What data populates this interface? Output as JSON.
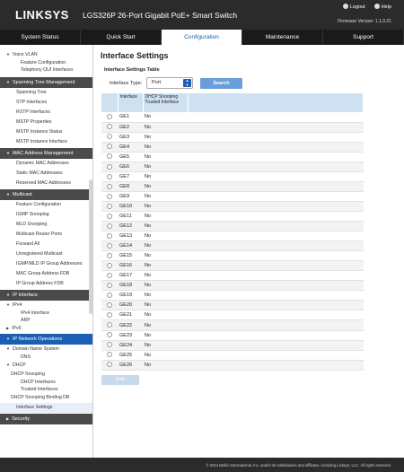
{
  "header": {
    "logo": "LINKSYS",
    "product": "LGS326P 26-Port Gigabit PoE+ Smart Switch",
    "logout": "Logout",
    "help": "Help",
    "firmware": "Firmware Version: 1.1.0.21"
  },
  "nav": {
    "tabs": [
      {
        "label": "System Status"
      },
      {
        "label": "Quick Start"
      },
      {
        "label": "Configuration"
      },
      {
        "label": "Maintenance"
      },
      {
        "label": "Support"
      }
    ]
  },
  "sidebar": {
    "voice_vlan": "Voice VLAN",
    "vv_items": [
      "Feature Configuration",
      "Telephony OUI Interfaces"
    ],
    "stm": "Spanning Tree Management",
    "stm_items": [
      "Spanning Tree",
      "STP Interfaces",
      "RSTP Interfaces",
      "MSTP Properties",
      "MSTP Instance Status",
      "MSTP Instance Interface"
    ],
    "mac": "MAC Address Management",
    "mac_items": [
      "Dynamic MAC Addresses",
      "Static MAC Addresses",
      "Reserved MAC Addresses"
    ],
    "multicast": "Multicast",
    "mc_items": [
      "Feature Configuration",
      "IGMP Snooping",
      "MLD Snooping",
      "Multicast Router Ports",
      "Forward All",
      "Unregistered Multicast",
      "IGMP/MLD IP Group Addresses",
      "MAC Group Address FDB",
      "IP Group Address FDB"
    ],
    "ip_interface": "IP Interface",
    "ipv4": "IPv4",
    "ipv4_items": [
      "IPv4 Interface",
      "ARP"
    ],
    "ipv6": "IPv6",
    "ip_net_ops": "IP Network Operations",
    "dns_group": "Domain Name System",
    "dns": "DNS",
    "dhcp": "DHCP",
    "dhcp_items": [
      "DHCP Snooping",
      "DHCP Interfaces",
      "Trusted Interfaces"
    ],
    "dhcp_binding": "DHCP Snooping Binding DB",
    "iface_settings": "Interface Settings",
    "security": "Security"
  },
  "main": {
    "title": "Interface Settings",
    "table_title": "Interface Settings Table",
    "iface_type_label": "Interface Type:",
    "iface_type_value": "Port",
    "search_label": "Search",
    "col_interface": "Interface",
    "col_dhcp": "DHCP Snooping Trusted Interface",
    "rows": [
      {
        "if": "GE1",
        "v": "No"
      },
      {
        "if": "GE2",
        "v": "No"
      },
      {
        "if": "GE3",
        "v": "No"
      },
      {
        "if": "GE4",
        "v": "No"
      },
      {
        "if": "GE5",
        "v": "No"
      },
      {
        "if": "GE6",
        "v": "No"
      },
      {
        "if": "GE7",
        "v": "No"
      },
      {
        "if": "GE8",
        "v": "No"
      },
      {
        "if": "GE9",
        "v": "No"
      },
      {
        "if": "GE10",
        "v": "No"
      },
      {
        "if": "GE11",
        "v": "No"
      },
      {
        "if": "GE12",
        "v": "No"
      },
      {
        "if": "GE13",
        "v": "No"
      },
      {
        "if": "GE14",
        "v": "No"
      },
      {
        "if": "GE15",
        "v": "No"
      },
      {
        "if": "GE16",
        "v": "No"
      },
      {
        "if": "GE17",
        "v": "No"
      },
      {
        "if": "GE18",
        "v": "No"
      },
      {
        "if": "GE19",
        "v": "No"
      },
      {
        "if": "GE20",
        "v": "No"
      },
      {
        "if": "GE21",
        "v": "No"
      },
      {
        "if": "GE22",
        "v": "No"
      },
      {
        "if": "GE23",
        "v": "No"
      },
      {
        "if": "GE24",
        "v": "No"
      },
      {
        "if": "GE25",
        "v": "No"
      },
      {
        "if": "GE26",
        "v": "No"
      }
    ],
    "edit_label": "Edit"
  },
  "footer": {
    "copyright": "© 2014 Belkin International, Inc. and/or its subsidiaries and affiliates, including Linksys, LLC. All rights reserved."
  },
  "colors": {
    "accent": "#1a5fb4",
    "header_bg": "#2b2b2b",
    "table_header": "#cfe0f1"
  }
}
